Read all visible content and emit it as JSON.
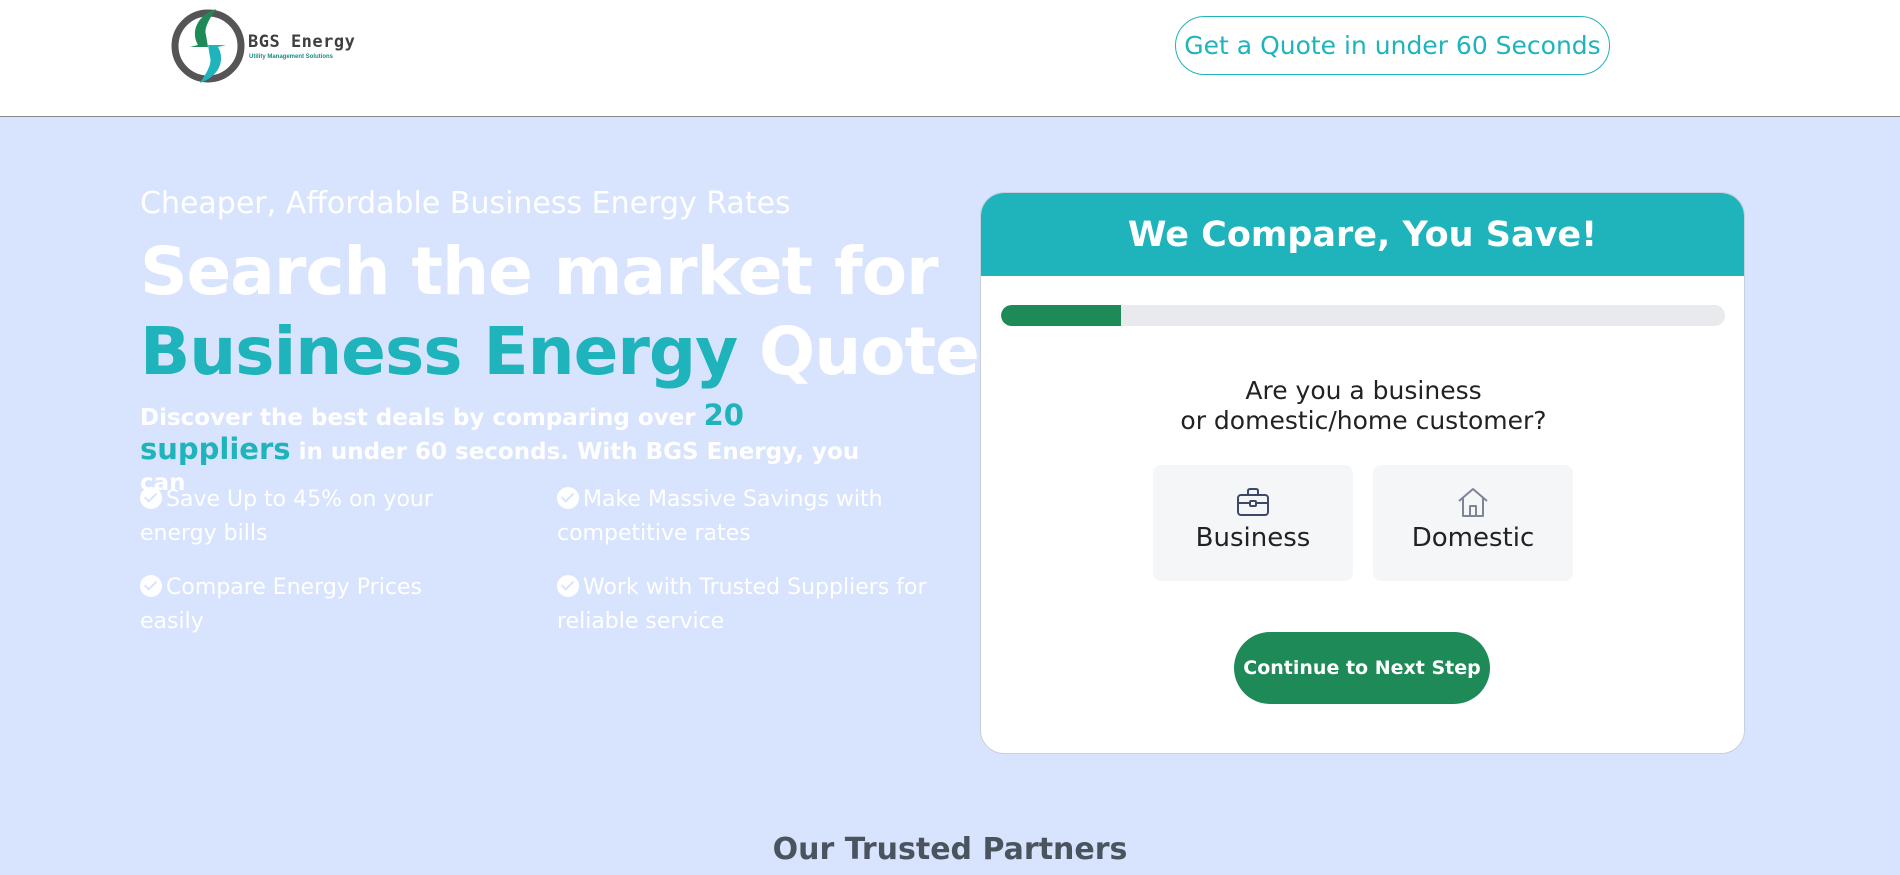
{
  "header": {
    "logo": {
      "name": "BGS Energy",
      "tagline": "Utility Management Solutions"
    },
    "quote_button": "Get a Quote in under 60 Seconds"
  },
  "hero": {
    "subtitle": "Cheaper, Affordable Business Energy Rates",
    "title_line1": "Search the market for",
    "title_accent": "Business Energy",
    "title_rest": "Quotes",
    "desc_prefix": "Discover the best deals by comparing over",
    "desc_accent": "20 suppliers",
    "desc_suffix": "in under 60 seconds. With BGS Energy, you can",
    "features": [
      {
        "text": "Save Up to 45% on your energy bills"
      },
      {
        "text": "Make Massive Savings with competitive rates"
      },
      {
        "text": "Compare Energy Prices easily"
      },
      {
        "text": "Work with Trusted Suppliers for reliable service"
      }
    ]
  },
  "form": {
    "title": "We Compare, You Save!",
    "progress": 0.166,
    "question_line1": "Are you a business",
    "question_line2": "or domestic/home customer?",
    "options": [
      {
        "label": "Business",
        "icon": "briefcase-icon"
      },
      {
        "label": "Domestic",
        "icon": "house-icon"
      }
    ],
    "next_button": "Continue to Next Step"
  },
  "partners": {
    "title": "Our Trusted Partners"
  },
  "colors": {
    "background": "#d8e3fd",
    "accent": "#1fb3bb",
    "primary_green": "#1e8a57",
    "white": "#ffffff"
  }
}
